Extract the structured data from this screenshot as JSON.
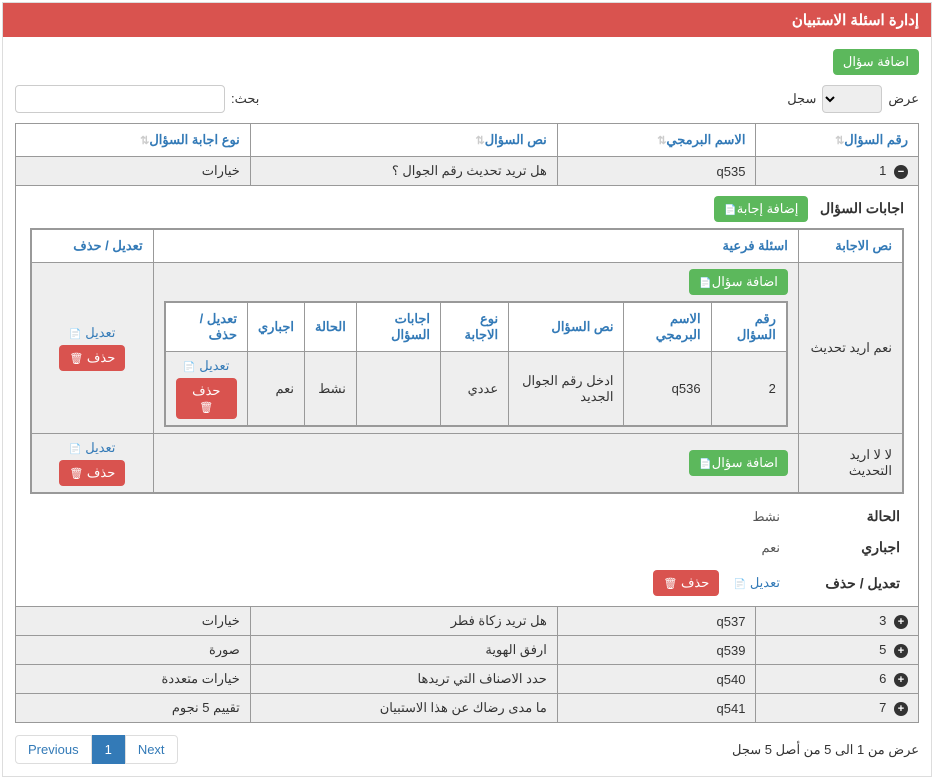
{
  "header": {
    "title": "إدارة اسئلة الاستبيان"
  },
  "top": {
    "add_question": "اضافة سؤال",
    "show_label": "عرض",
    "records_label": "سجل",
    "search_label": "بحث:"
  },
  "columns": {
    "q_no": "رقم السؤال",
    "code": "الاسم البرمجي",
    "text": "نص السؤال",
    "answer_type": "نوع اجابة السؤال"
  },
  "rows": [
    {
      "expand": "−",
      "no": "1",
      "code": "q535",
      "text": "هل تريد تحديث رقم الجوال ؟",
      "type": "خيارات"
    }
  ],
  "detail": {
    "answers_title": "اجابات السؤال",
    "add_answer": "إضافة إجابة",
    "inner_cols": {
      "answer_text": "نص الاجابة",
      "sub_q": "اسئلة فرعية",
      "edit_delete": "تعديل / حذف"
    },
    "add_subq": "اضافة سؤال",
    "sub_cols": {
      "q_no": "رقم السؤال",
      "code": "الاسم البرمجي",
      "text": "نص السؤال",
      "ans_type": "نوع الاجابة",
      "q_answers": "اجابات السؤال",
      "status": "الحالة",
      "required": "اجباري",
      "edit_delete": "تعديل / حذف"
    },
    "answers": [
      {
        "text": "نعم اريد تحديث",
        "sub": [
          {
            "no": "2",
            "code": "q536",
            "text": "ادخل رقم الجوال الجديد",
            "ans_type": "عددي",
            "q_answers": "",
            "status": "نشط",
            "required": "نعم"
          }
        ]
      },
      {
        "text": "لا لا اريد التحديث",
        "sub": []
      }
    ],
    "status_label": "الحالة",
    "status_value": "نشط",
    "required_label": "اجباري",
    "required_value": "نعم",
    "edit_delete_label": "تعديل / حذف",
    "edit": "تعديل",
    "delete": "حذف"
  },
  "rest_rows": [
    {
      "no": "3",
      "code": "q537",
      "text": "هل تريد زكاة فطر",
      "type": "خيارات"
    },
    {
      "no": "5",
      "code": "q539",
      "text": "ارفق الهوية",
      "type": "صورة"
    },
    {
      "no": "6",
      "code": "q540",
      "text": "حدد الاصناف التي تريدها",
      "type": "خيارات متعددة"
    },
    {
      "no": "7",
      "code": "q541",
      "text": "ما مدى رضاك عن هذا الاستبيان",
      "type": "تقييم 5 نجوم"
    }
  ],
  "footer": {
    "info": "عرض من 1 الى 5 من أصل 5 سجل",
    "prev": "Previous",
    "page": "1",
    "next": "Next"
  },
  "shared": {
    "edit": "تعديل",
    "delete": "حذف"
  }
}
